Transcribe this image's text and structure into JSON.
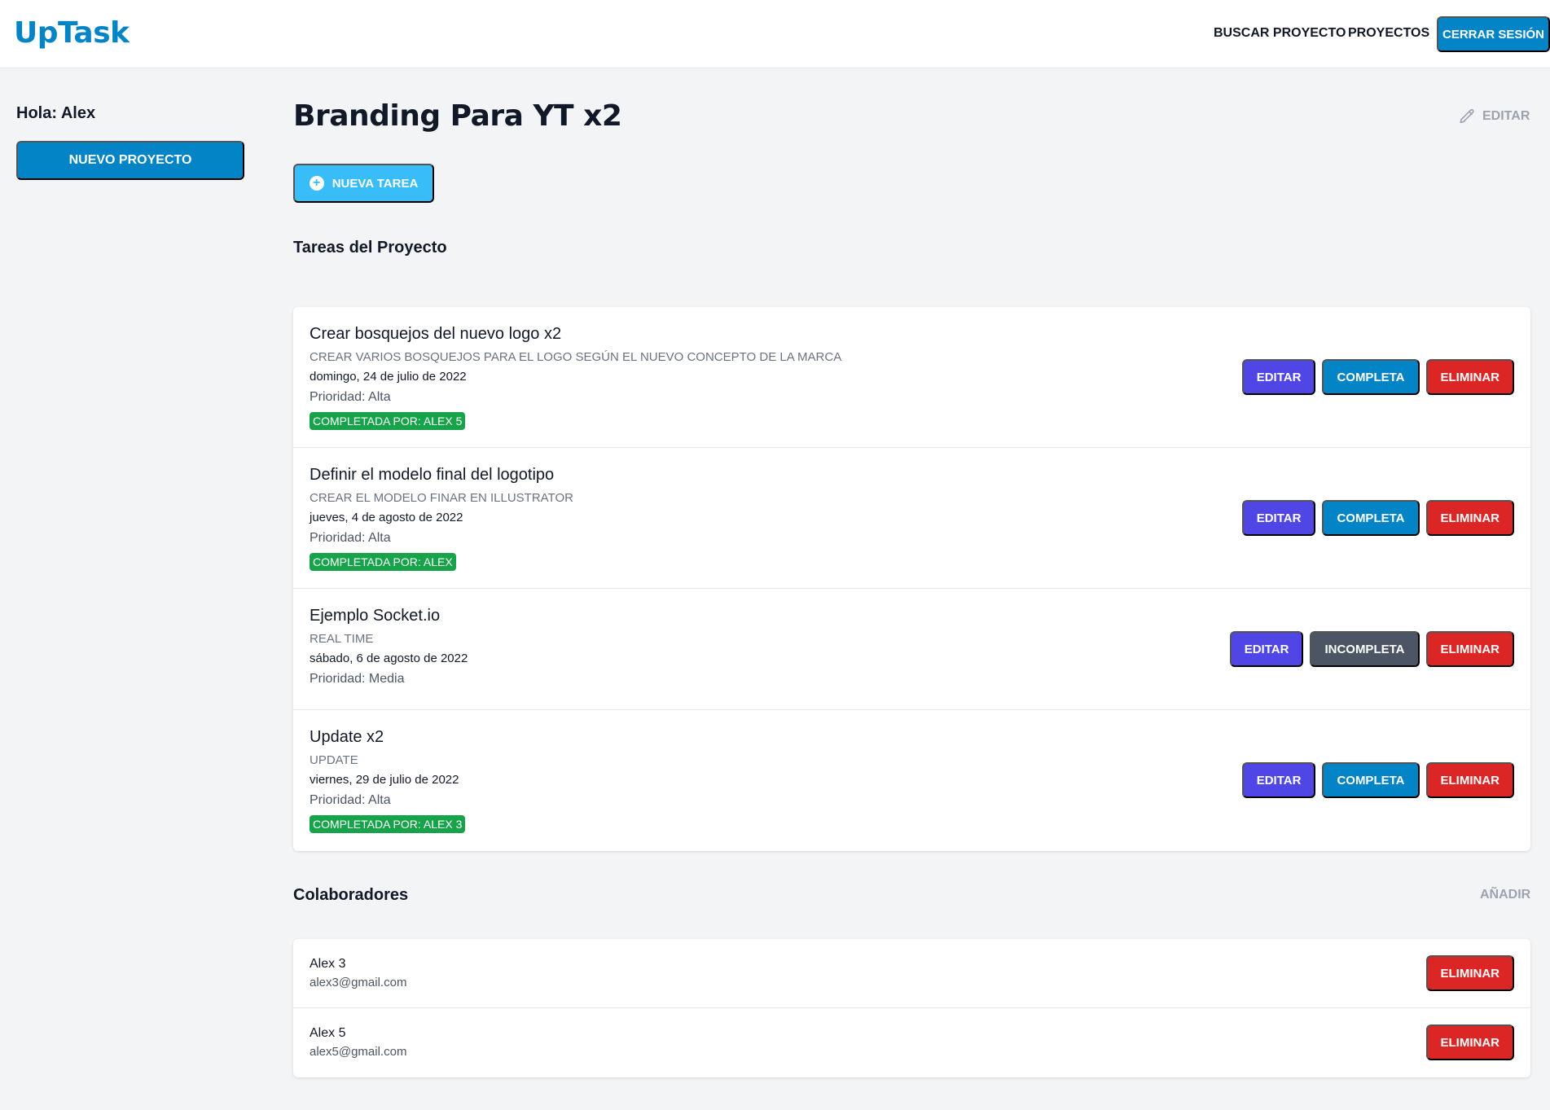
{
  "header": {
    "logo": "UpTask",
    "nav": [
      "BUSCAR PROYECTO",
      "PROYECTOS"
    ],
    "logout_label": "CERRAR SESIÓN"
  },
  "sidebar": {
    "greeting": "Hola: Alex",
    "new_project_label": "NUEVO PROYECTO"
  },
  "project": {
    "title": "Branding Para YT x2",
    "edit_label": "EDITAR",
    "new_task_label": "NUEVA TAREA",
    "tasks_heading": "Tareas del Proyecto",
    "collaborators_heading": "Colaboradores",
    "add_collaborator_label": "AÑADIR"
  },
  "tasks": [
    {
      "name": "Crear bosquejos del nuevo logo x2",
      "description": "CREAR VARIOS BOSQUEJOS PARA EL LOGO SEGÚN EL NUEVO CONCEPTO DE LA MARCA",
      "date": "domingo, 24 de julio de 2022",
      "priority": "Prioridad: Alta",
      "completed_by": "COMPLETADA POR: ALEX 5",
      "edit_label": "EDITAR",
      "state_label": "COMPLETA",
      "delete_label": "ELIMINAR"
    },
    {
      "name": "Definir el modelo final del logotipo",
      "description": "CREAR EL MODELO FINAR EN ILLUSTRATOR",
      "date": "jueves, 4 de agosto de 2022",
      "priority": "Prioridad: Alta",
      "completed_by": "COMPLETADA POR: ALEX",
      "edit_label": "EDITAR",
      "state_label": "COMPLETA",
      "delete_label": "ELIMINAR"
    },
    {
      "name": "Ejemplo Socket.io",
      "description": "REAL TIME",
      "date": "sábado, 6 de agosto de 2022",
      "priority": "Prioridad: Media",
      "completed_by": null,
      "edit_label": "EDITAR",
      "state_label": "INCOMPLETA",
      "delete_label": "ELIMINAR"
    },
    {
      "name": "Update x2",
      "description": "UPDATE",
      "date": "viernes, 29 de julio de 2022",
      "priority": "Prioridad: Alta",
      "completed_by": "COMPLETADA POR: ALEX 3",
      "edit_label": "EDITAR",
      "state_label": "COMPLETA",
      "delete_label": "ELIMINAR"
    }
  ],
  "collaborators": [
    {
      "name": "Alex 3",
      "email": "alex3@gmail.com",
      "delete_label": "ELIMINAR"
    },
    {
      "name": "Alex 5",
      "email": "alex5@gmail.com",
      "delete_label": "ELIMINAR"
    }
  ],
  "colors": {
    "brand": "#0284c7",
    "new_task": "#38bdf8",
    "edit": "#4f46e5",
    "incomplete": "#4b5563",
    "delete": "#dc2626",
    "completed_badge": "#16a34a"
  }
}
